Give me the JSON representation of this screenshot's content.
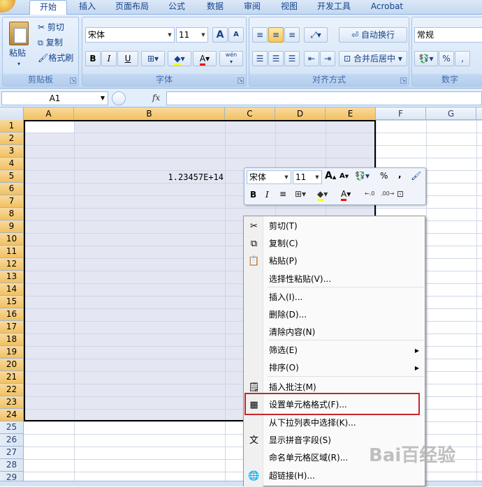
{
  "tabs": [
    "开始",
    "插入",
    "页面布局",
    "公式",
    "数据",
    "审阅",
    "视图",
    "开发工具",
    "Acrobat"
  ],
  "clipboard": {
    "paste": "粘贴",
    "cut": "剪切",
    "copy": "复制",
    "format_painter": "格式刷",
    "group_label": "剪贴板"
  },
  "font": {
    "name": "宋体",
    "size": "11",
    "grow": "A",
    "shrink": "A",
    "bold": "B",
    "italic": "I",
    "underline": "U",
    "phonetic": "wén",
    "group_label": "字体"
  },
  "alignment": {
    "wrap": "自动换行",
    "merge": "合并后居中",
    "group_label": "对齐方式"
  },
  "number": {
    "format": "常规",
    "percent": "%",
    "group_label": "数字"
  },
  "formula_bar": {
    "name_box": "A1",
    "fx": "fx",
    "formula": ""
  },
  "columns": [
    "A",
    "B",
    "C",
    "D",
    "E",
    "F",
    "G"
  ],
  "rows": [
    "1",
    "2",
    "3",
    "4",
    "5",
    "6",
    "7",
    "8",
    "9",
    "10",
    "11",
    "12",
    "13",
    "14",
    "15",
    "16",
    "17",
    "18",
    "19",
    "20",
    "21",
    "22",
    "23",
    "24",
    "25",
    "26",
    "27",
    "28",
    "29"
  ],
  "cell_b5": "1.23457E+14",
  "mini_toolbar": {
    "font": "宋体",
    "size": "11",
    "percent": "%",
    "comma": ",",
    "bold": "B",
    "italic": "I",
    "inc_decimal": ".0 .00",
    "dec_decimal": ".00 .0"
  },
  "context_menu": [
    {
      "label": "剪切(T)",
      "icon": "scissors-icon"
    },
    {
      "label": "复制(C)",
      "icon": "copy-icon"
    },
    {
      "label": "粘贴(P)",
      "icon": "paste-icon"
    },
    {
      "label": "选择性粘贴(V)...",
      "icon": ""
    },
    {
      "label": "插入(I)...",
      "icon": ""
    },
    {
      "label": "删除(D)...",
      "icon": ""
    },
    {
      "label": "清除内容(N)",
      "icon": ""
    },
    {
      "label": "筛选(E)",
      "icon": "",
      "submenu": true
    },
    {
      "label": "排序(O)",
      "icon": "",
      "submenu": true
    },
    {
      "label": "插入批注(M)",
      "icon": "comment-icon"
    },
    {
      "label": "设置单元格格式(F)...",
      "icon": "format-cells-icon",
      "highlighted": true
    },
    {
      "label": "从下拉列表中选择(K)...",
      "icon": ""
    },
    {
      "label": "显示拼音字段(S)",
      "icon": "phonetic-icon"
    },
    {
      "label": "命名单元格区域(R)...",
      "icon": ""
    },
    {
      "label": "超链接(H)...",
      "icon": "hyperlink-icon"
    }
  ],
  "watermark": "Bai百经验"
}
